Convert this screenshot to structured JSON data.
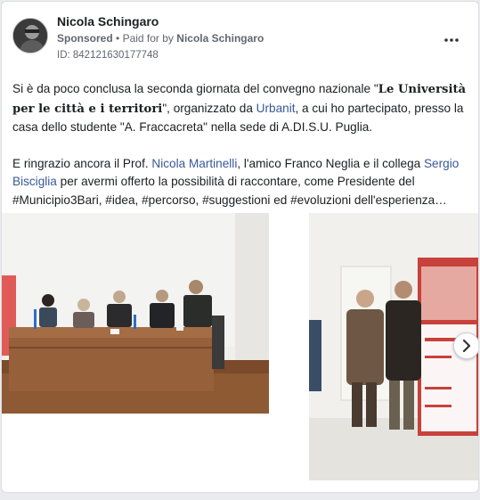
{
  "post": {
    "author": "Nicola Schingaro",
    "sponsored_label": "Sponsored",
    "separator": "•",
    "paid_for_label": "Paid for by",
    "paid_for_by": "Nicola Schingaro",
    "ad_id": "ID: 842121630177748",
    "more_icon": "more-horizontal-icon",
    "more_label": "•••"
  },
  "body": {
    "p1_a": "Si è da poco conclusa la seconda giornata del convegno nazionale \"",
    "p1_title": "Le Università per le città e i territori",
    "p1_b": "\", organizzato da ",
    "p1_link1": "Urbanit",
    "p1_c": ", a cui ho partecipato, presso la casa dello studente \"A. Fraccacreta\" nella sede di A.DI.S.U. Puglia.",
    "p2_a": "E ringrazio ancora il Prof. ",
    "p2_link1": "Nicola Martinelli",
    "p2_b": ", l'amico Franco Neglia e il collega ",
    "p2_link2": "Sergio Bisciglia",
    "p2_c": " per avermi offerto la possibilità di raccontare, come Presidente del #Municipio3Bari, #idea, #percorso, #suggestioni ed #evoluzioni dell'esperienza…"
  },
  "carousel": {
    "next_icon": "chevron-right-icon"
  },
  "colors": {
    "link": "#385898",
    "text": "#1c1e21",
    "muted": "#606770",
    "banner_red": "#c8413a"
  }
}
